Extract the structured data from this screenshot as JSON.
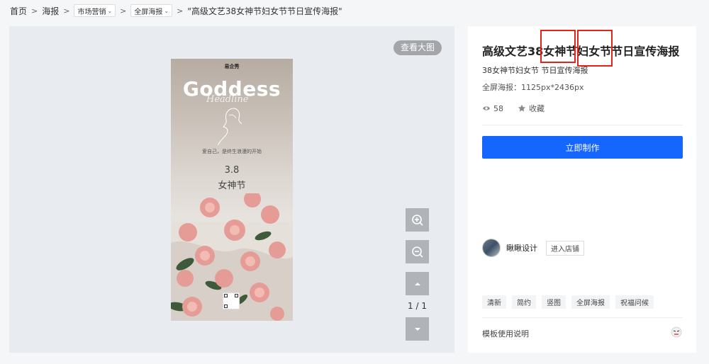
{
  "breadcrumb": {
    "home": "首页",
    "sep": ">",
    "poster": "海报",
    "category": "市场营销",
    "subcategory": "全屏海报",
    "current": "\"高级文艺38女神节妇女节节日宣传海报\""
  },
  "preview": {
    "view_large": "查看大图",
    "page_indicator": "1 / 1",
    "poster": {
      "brand": "易企秀",
      "headline": "Goddess",
      "script": "Headline",
      "tagline": "爱自己，是终生浪漫的开始",
      "date": "3.8",
      "festival": "女神节"
    }
  },
  "info": {
    "title": "高级文艺38女神节妇女节节日宣传海报",
    "subtitle": "38女神节妇女节 节日宣传海报",
    "specs": "全屏海报：1125px*2436px",
    "views": "58",
    "favorite": "收藏",
    "make_button": "立即制作",
    "designer": "瞅瞅设计",
    "shop_button": "进入店铺",
    "tags": [
      "清新",
      "简约",
      "竖图",
      "全屏海报",
      "祝福问候"
    ],
    "help": "模板使用说明"
  },
  "colors": {
    "primary": "#1565ff",
    "highlight_box": "#e0241b",
    "preview_bg": "#e8ebef"
  }
}
